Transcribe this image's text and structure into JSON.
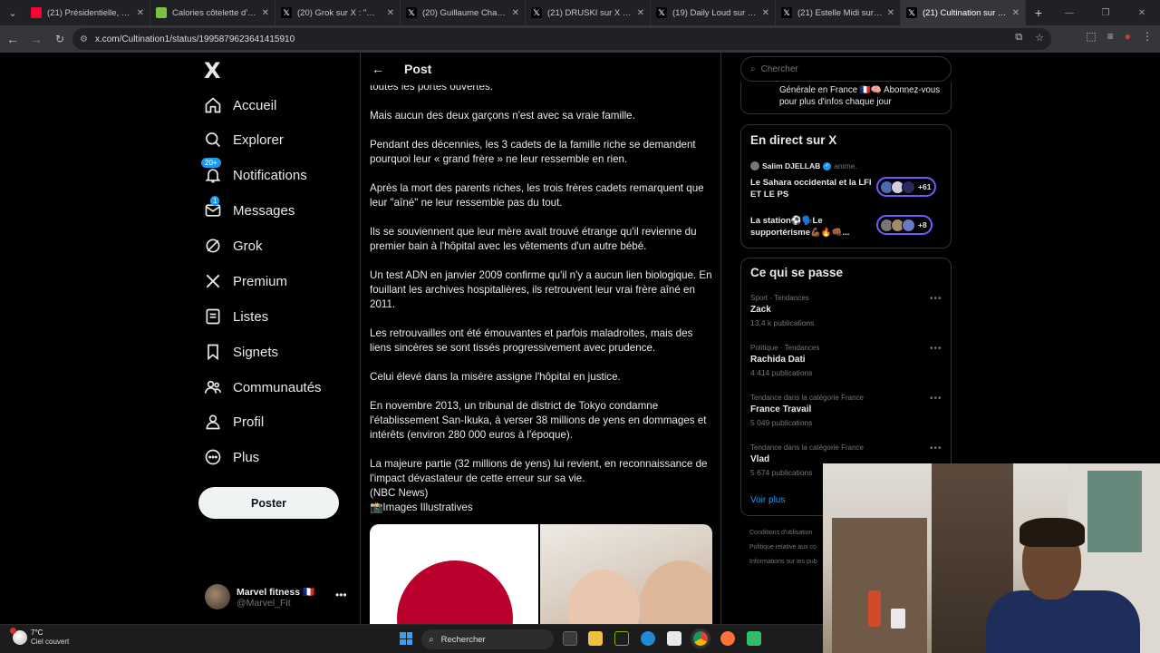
{
  "browser": {
    "tabs": [
      {
        "label": "(21) Présidentielle, budget",
        "favicon_color": "#ff0033",
        "active": false
      },
      {
        "label": "Calories côtelette d'agneau",
        "favicon_color": "#7cc142",
        "active": false
      },
      {
        "label": "(20) Grok sur X : \"@raphae",
        "favicon_color": "#000000",
        "active": false
      },
      {
        "label": "(20) Guillaume Champeau",
        "favicon_color": "#000000",
        "active": false
      },
      {
        "label": "(21) DRUSKI sur X : \"Dude",
        "favicon_color": "#000000",
        "active": false
      },
      {
        "label": "(19) Daily Loud sur X : \"2",
        "favicon_color": "#000000",
        "active": false
      },
      {
        "label": "(21) Estelle Midi sur X : \"",
        "favicon_color": "#000000",
        "active": false
      },
      {
        "label": "(21) Cultination sur X : \"",
        "favicon_color": "#000000",
        "active": true
      }
    ],
    "url": "x.com/Cultination1/status/1995879623641415910"
  },
  "sidebar": {
    "logo": "X",
    "items": [
      {
        "label": "Accueil",
        "icon": "home-icon"
      },
      {
        "label": "Explorer",
        "icon": "search-icon"
      },
      {
        "label": "Notifications",
        "icon": "bell-icon",
        "badge": "20+"
      },
      {
        "label": "Messages",
        "icon": "mail-icon",
        "badge": "1"
      },
      {
        "label": "Grok",
        "icon": "grok-icon"
      },
      {
        "label": "Premium",
        "icon": "x-icon"
      },
      {
        "label": "Listes",
        "icon": "list-icon"
      },
      {
        "label": "Signets",
        "icon": "bookmark-icon"
      },
      {
        "label": "Communautés",
        "icon": "people-icon"
      },
      {
        "label": "Profil",
        "icon": "person-icon"
      },
      {
        "label": "Plus",
        "icon": "more-circle-icon"
      }
    ],
    "post_button": "Poster",
    "account": {
      "name": "Marvel fitness 🇫🇷",
      "handle": "@Marvel_Fit"
    }
  },
  "post": {
    "header_title": "Post",
    "paragraphs": [
      "toutes les portes ouvertes.",
      "Mais aucun des deux garçons n'est avec sa vraie famille.",
      "Pendant des décennies, les 3 cadets de la famille riche se demandent pourquoi leur « grand frère » ne leur ressemble en rien.",
      " Après la mort des parents riches, les trois frères cadets remarquent que leur \"aîné\" ne leur ressemble pas du tout.",
      "Ils se souviennent que leur mère avait trouvé étrange qu'il revienne du premier bain à l'hôpital avec les vêtements d'un autre bébé.",
      "Un test ADN en janvier 2009 confirme qu'il n'y a aucun lien biologique. En fouillant les archives hospitalières, ils retrouvent leur vrai frère aîné en 2011.",
      "Les retrouvailles ont été émouvantes et parfois maladroites, mais des liens sincères se sont tissés progressivement avec prudence.",
      "Celui élevé dans la misère assigne l'hôpital en justice.",
      "En novembre 2013, un tribunal de district de Tokyo condamne l'établissement San-Ikuka, à verser 38 millions de yens en dommages et intérêts (environ 280 000 euros à l'époque).",
      "La majeure partie (32 millions de yens) lui revient, en reconnaissance de l'impact dévastateur de cette erreur sur sa vie."
    ],
    "source": "(NBC News)",
    "images_note": "📸Images Illustratives"
  },
  "right": {
    "search_placeholder": "Chercher",
    "subscribe_text": "Générale en France 🇫🇷🧠 Abonnez-vous pour plus d'infos chaque jour",
    "live": {
      "title": "En direct sur X",
      "author": "Salim DJELLAB",
      "author_suffix": "anime.",
      "spaces": [
        {
          "title": "Le Sahara occidental et la LFI ET LE PS",
          "count": "+61"
        },
        {
          "title": "La station⚽🗣️Le supportérisme💪🏾🔥👊🏾...",
          "count": "+8"
        }
      ]
    },
    "trends": {
      "title": "Ce qui se passe",
      "items": [
        {
          "category": "Sport · Tendances",
          "name": "Zack",
          "count": "13,4 k publications"
        },
        {
          "category": "Politique · Tendances",
          "name": "Rachida Dati",
          "count": "4 414 publications"
        },
        {
          "category": "Tendance dans la catégorie France",
          "name": "France Travail",
          "count": "5 049 publications"
        },
        {
          "category": "Tendance dans la catégorie France",
          "name": "Vlad",
          "count": "5 674 publications"
        }
      ],
      "more": "Voir plus"
    },
    "footer": [
      "Conditions d'utilisation",
      "Politique relative aux co",
      "Informations sur les pub"
    ]
  },
  "taskbar": {
    "temperature": "7°C",
    "weather": "Ciel couvert",
    "search": "Rechercher"
  }
}
